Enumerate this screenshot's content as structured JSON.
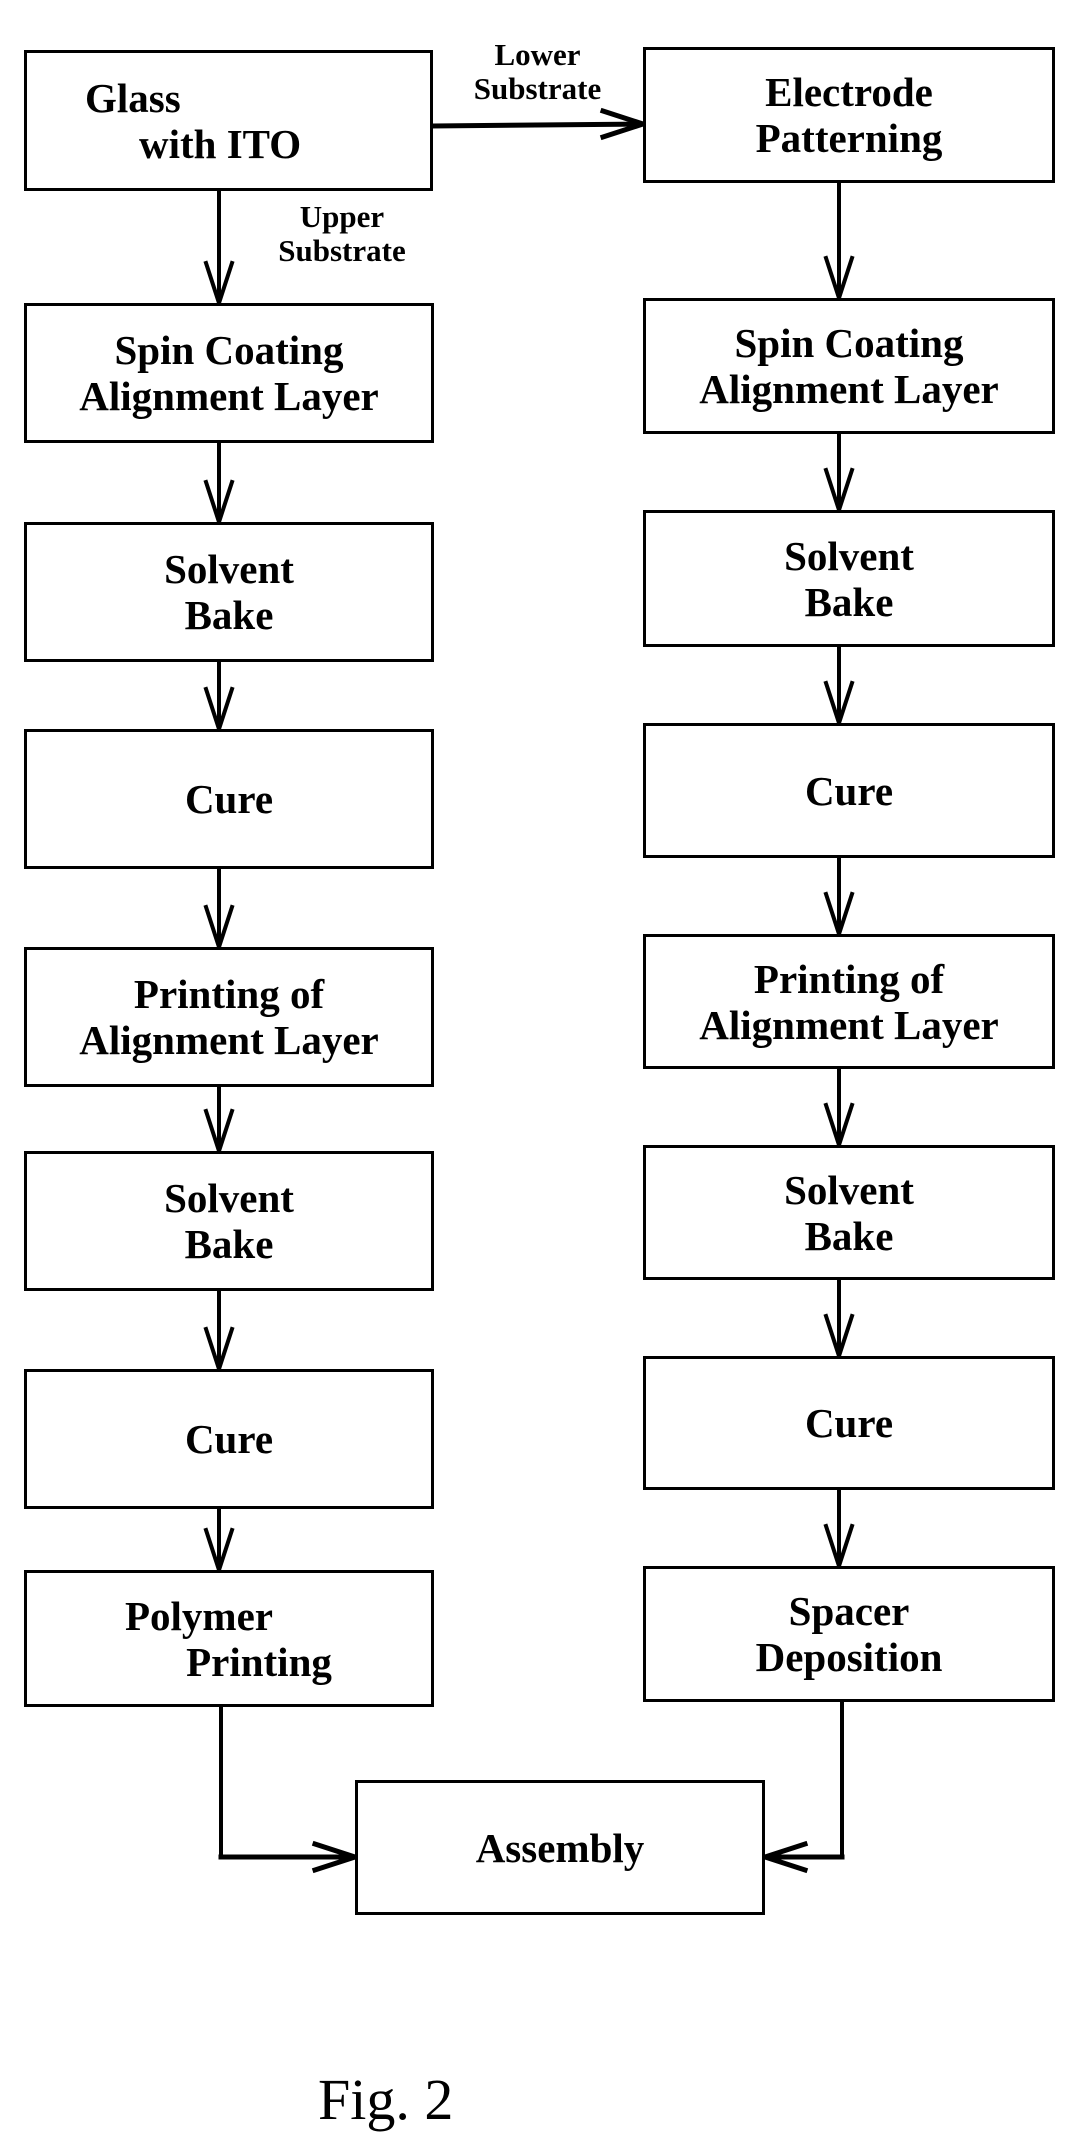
{
  "figure": {
    "caption": "Fig. 2",
    "start": {
      "lines": [
        "Glass",
        "with ITO"
      ]
    },
    "branch_labels": {
      "upper": [
        "Upper",
        "Substrate"
      ],
      "lower": [
        "Lower",
        "Substrate"
      ]
    },
    "upper_substrate_steps": [
      {
        "lines": [
          "Spin Coating",
          "Alignment Layer"
        ]
      },
      {
        "lines": [
          "Solvent",
          "Bake"
        ]
      },
      {
        "lines": [
          "Cure"
        ]
      },
      {
        "lines": [
          "Printing of",
          "Alignment Layer"
        ]
      },
      {
        "lines": [
          "Solvent",
          "Bake"
        ]
      },
      {
        "lines": [
          "Cure"
        ]
      },
      {
        "lines": [
          "Polymer",
          "Printing"
        ]
      }
    ],
    "lower_substrate_steps": [
      {
        "lines": [
          "Electrode",
          "Patterning"
        ]
      },
      {
        "lines": [
          "Spin Coating",
          "Alignment Layer"
        ]
      },
      {
        "lines": [
          "Solvent",
          "Bake"
        ]
      },
      {
        "lines": [
          "Cure"
        ]
      },
      {
        "lines": [
          "Printing of",
          "Alignment Layer"
        ]
      },
      {
        "lines": [
          "Solvent",
          "Bake"
        ]
      },
      {
        "lines": [
          "Cure"
        ]
      },
      {
        "lines": [
          "Spacer",
          "Deposition"
        ]
      }
    ],
    "end": {
      "lines": [
        "Assembly"
      ]
    },
    "colors": {
      "stroke": "#000000",
      "background": "#ffffff"
    }
  }
}
